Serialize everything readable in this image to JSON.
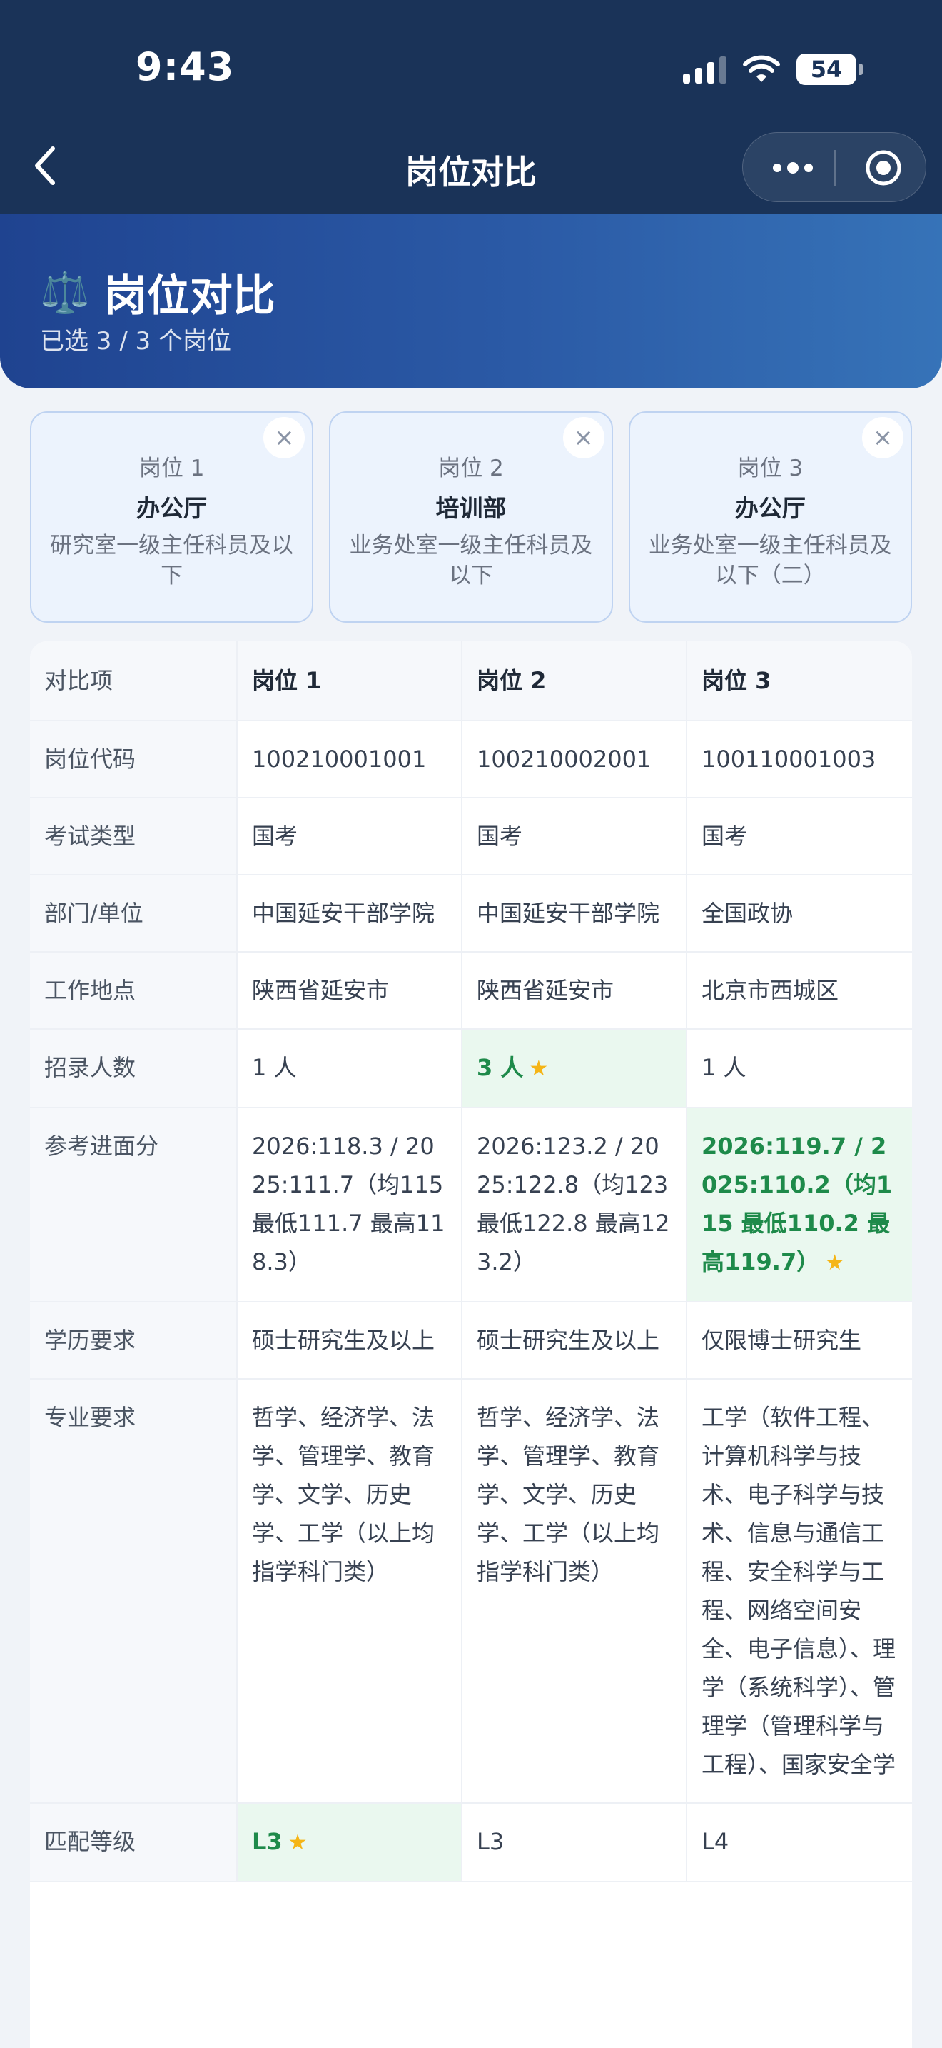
{
  "status": {
    "time": "9:43",
    "battery": "54"
  },
  "nav": {
    "title": "岗位对比"
  },
  "hero": {
    "title": "岗位对比",
    "icon": "⚖️",
    "subtitle": "已选 3 / 3 个岗位"
  },
  "cards": [
    {
      "label": "岗位 1",
      "dept": "办公厅",
      "desc": "研究室一级主任科员及以下"
    },
    {
      "label": "岗位 2",
      "dept": "培训部",
      "desc": "业务处室一级主任科员及以下"
    },
    {
      "label": "岗位 3",
      "dept": "办公厅",
      "desc": "业务处室一级主任科员及以下（二）"
    }
  ],
  "table": {
    "headers": [
      "对比项",
      "岗位 1",
      "岗位 2",
      "岗位 3"
    ],
    "rows": [
      {
        "key": "岗位代码",
        "values": [
          "100210001001",
          "100210002001",
          "100110001003"
        ],
        "best": []
      },
      {
        "key": "考试类型",
        "values": [
          "国考",
          "国考",
          "国考"
        ],
        "best": []
      },
      {
        "key": "部门/单位",
        "values": [
          "中国延安干部学院",
          "中国延安干部学院",
          "全国政协"
        ],
        "best": []
      },
      {
        "key": "工作地点",
        "values": [
          "陕西省延安市",
          "陕西省延安市",
          "北京市西城区"
        ],
        "best": []
      },
      {
        "key": "招录人数",
        "values": [
          "1 人",
          "3 人",
          "1 人"
        ],
        "best": [
          1
        ]
      },
      {
        "key": "参考进面分",
        "values": [
          "2026:118.3 / 2025:111.7（均115 最低111.7 最高118.3）",
          "2026:123.2 / 2025:122.8（均123 最低122.8 最高123.2）",
          "2026:119.7 / 2025:110.2（均115 最低110.2 最高119.7）"
        ],
        "best": [
          2
        ]
      },
      {
        "key": "学历要求",
        "values": [
          "硕士研究生及以上",
          "硕士研究生及以上",
          "仅限博士研究生"
        ],
        "best": []
      },
      {
        "key": "专业要求",
        "values": [
          "哲学、经济学、法学、管理学、教育学、文学、历史学、工学（以上均指学科门类）",
          "哲学、经济学、法学、管理学、教育学、文学、历史学、工学（以上均指学科门类）",
          "工学（软件工程、计算机科学与技术、电子科学与技术、信息与通信工程、安全科学与工程、网络空间安全、电子信息）、理学（系统科学）、管理学（管理科学与工程）、国家安全学"
        ],
        "best": []
      },
      {
        "key": "匹配等级",
        "values": [
          "L3",
          "L3",
          "L4"
        ],
        "best": [
          0
        ]
      }
    ]
  },
  "colors": {
    "nav_bg": "#1a3358",
    "hero_start": "#1f4390",
    "hero_end": "#3673b8",
    "best_bg": "#eaf8ef",
    "best_text": "#1e8a4a",
    "star": "#f5b516"
  }
}
